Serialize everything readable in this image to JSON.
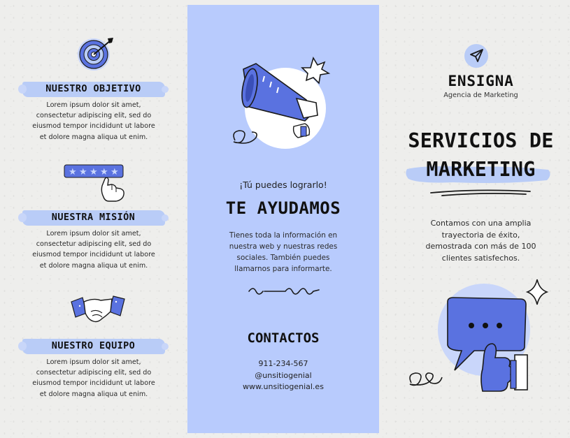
{
  "colors": {
    "accent": "#5a72e0",
    "panel": "#b8cbfd",
    "highlight": "#b9ccf7",
    "ink": "#111111"
  },
  "left": {
    "sections": [
      {
        "icon": "target-icon",
        "title": "NUESTRO OBJETIVO",
        "body": [
          "Lorem ipsum dolor sit amet,",
          "consectetur adipiscing elit, sed do",
          "eiusmod tempor incididunt ut labore",
          "et dolore magna aliqua ut enim."
        ]
      },
      {
        "icon": "stars-rating-icon",
        "title": "NUESTRA MISIÓN",
        "body": [
          "Lorem ipsum dolor sit amet,",
          "consectetur adipiscing elit, sed do",
          "eiusmod tempor incididunt ut labore",
          "et dolore magna aliqua ut enim."
        ]
      },
      {
        "icon": "handshake-icon",
        "title": "NUESTRO EQUIPO",
        "body": [
          "Lorem ipsum dolor sit amet,",
          "consectetur adipiscing elit, sed do",
          "eiusmod tempor incididunt ut labore",
          "et dolore magna aliqua ut enim."
        ]
      }
    ]
  },
  "middle": {
    "illustration": "megaphone-icon",
    "tagline": "¡Tú puedes lograrlo!",
    "headline": "TE AYUDAMOS",
    "body": [
      "Tienes toda la información en",
      "nuestra web y nuestras redes",
      "sociales. También puedes",
      "llamarnos para informarte."
    ],
    "contacts_title": "CONTACTOS",
    "contacts": [
      "911-234-567",
      "@unsitiogenial",
      "www.unsitiogenial.es"
    ]
  },
  "right": {
    "logo_icon": "send-arrow-icon",
    "brand": "ENSIGNA",
    "subtitle": "Agencia de Marketing",
    "title_line1": "SERVICIOS DE",
    "title_line2": "MARKETING",
    "body": [
      "Contamos con una amplia",
      "trayectoria de éxito,",
      "demostrada con más de 100",
      "clientes satisfechos."
    ],
    "illustration": "chat-thumbs-up-icon"
  }
}
